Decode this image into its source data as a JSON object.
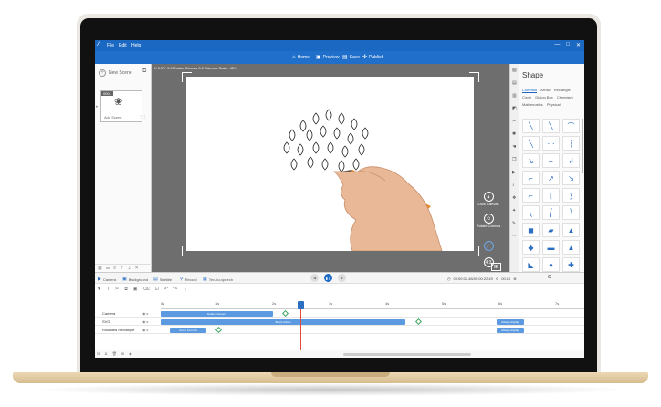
{
  "menubar": {
    "logo": "⁄",
    "items": [
      "File",
      "Edit",
      "Help"
    ],
    "window_buttons": [
      "—",
      "□",
      "✕"
    ]
  },
  "top_toolbar": {
    "home": "Home",
    "preview": "Preview",
    "save": "Save",
    "publish": "Publish"
  },
  "left_panel": {
    "new_scene": "New Scene",
    "scene": {
      "number": "0001",
      "add_label": "Add Scene"
    }
  },
  "canvas": {
    "info": "X 0.0 Y 0.0 Rotate Canvas 0.0 Camera Scale: 45%",
    "lock_canvas": "Lock Canvas",
    "rotate_canvas": "Rotate Canvas",
    "zoom_43": "4:3",
    "zoom_169": "16:9"
  },
  "right_panel": {
    "title": "Shape",
    "categories": [
      "Common",
      "Arrow",
      "Rectangle",
      "Circle",
      "Dialog Box",
      "Chemistry",
      "Mathematics",
      "Physical"
    ],
    "active_category": "Common",
    "shapes": [
      "╲",
      "╲",
      "⌒",
      "╲",
      "⋯",
      "┆",
      "↘",
      "⌐",
      "↲",
      "⌐",
      "↗",
      "↘",
      "⌐",
      "⁅",
      "⟆",
      "⎝",
      "⎛",
      "⎞",
      "◼",
      "▰",
      "▲",
      "◆",
      "▬",
      "▲",
      "◣",
      "●",
      "✚"
    ]
  },
  "timeline_toolbar": {
    "camera": "Camera",
    "background": "Background",
    "subtitle": "Subtitle",
    "record": "Record",
    "tts": "Text-to-speech",
    "time": "00:00:02.48/00:00:22.49",
    "speed": "00:10"
  },
  "timeline": {
    "ruler": [
      "0s",
      "1s",
      "2s",
      "3s",
      "4s",
      "5s",
      "6s",
      "7s"
    ],
    "tracks": [
      {
        "name": "Camera",
        "bar_label": "Default Camera"
      },
      {
        "name": "SVG",
        "bar_label": "Brush drawn",
        "end_label": "Always display"
      },
      {
        "name": "Rounded Rectangle",
        "bar_label": "Zoom from left",
        "end_label": "Always display"
      }
    ]
  }
}
